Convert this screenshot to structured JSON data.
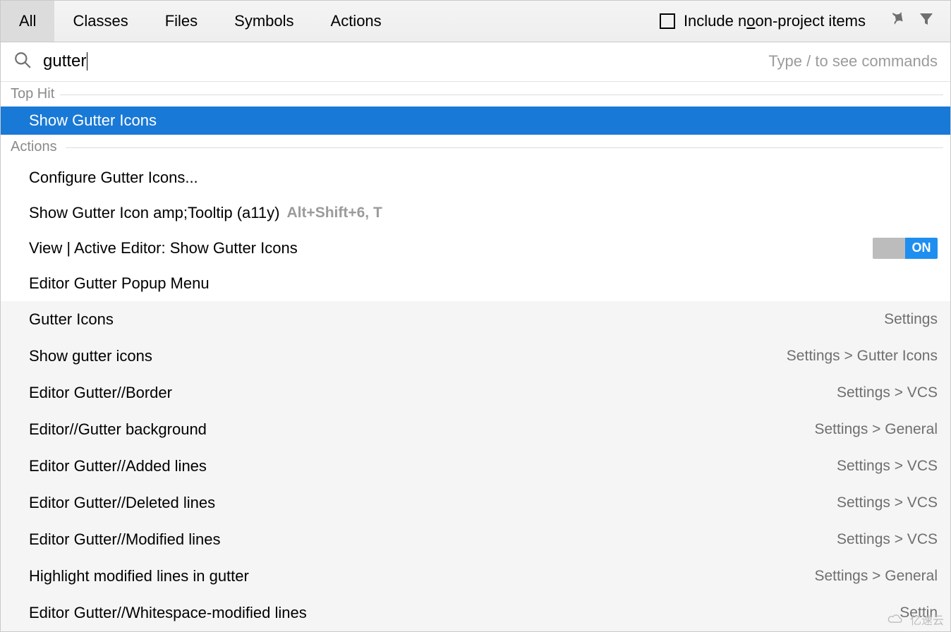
{
  "tabs": {
    "all": "All",
    "classes": "Classes",
    "files": "Files",
    "symbols": "Symbols",
    "actions": "Actions"
  },
  "include_nonproject_prefix": "Include n",
  "include_nonproject_suffix": "on-project items",
  "search": {
    "value": "gutter",
    "hint": "Type / to see commands"
  },
  "sections": {
    "tophit": "Top Hit",
    "actions": "Actions"
  },
  "tophit": {
    "label": "Show Gutter Icons"
  },
  "actions": {
    "a0": "Configure Gutter Icons...",
    "a1": "Show Gutter Icon amp;Tooltip (a11y)",
    "a1_shortcut": "Alt+Shift+6, T",
    "a2": "View | Active Editor: Show Gutter Icons",
    "a2_toggle": "ON",
    "a3": "Editor Gutter Popup Menu",
    "g0": "Gutter Icons",
    "g0_loc": "Settings",
    "g1": "Show gutter icons",
    "g1_loc": "Settings > Gutter Icons",
    "g2": "Editor Gutter//Border",
    "g2_loc": "Settings > VCS",
    "g3": "Editor//Gutter background",
    "g3_loc": "Settings > General",
    "g4": "Editor Gutter//Added lines",
    "g4_loc": "Settings > VCS",
    "g5": "Editor Gutter//Deleted lines",
    "g5_loc": "Settings > VCS",
    "g6": "Editor Gutter//Modified lines",
    "g6_loc": "Settings > VCS",
    "g7": "Highlight modified lines in gutter",
    "g7_loc": "Settings > General",
    "g8": "Editor Gutter//Whitespace-modified lines",
    "g8_loc": "Settin"
  },
  "watermark": "亿速云"
}
